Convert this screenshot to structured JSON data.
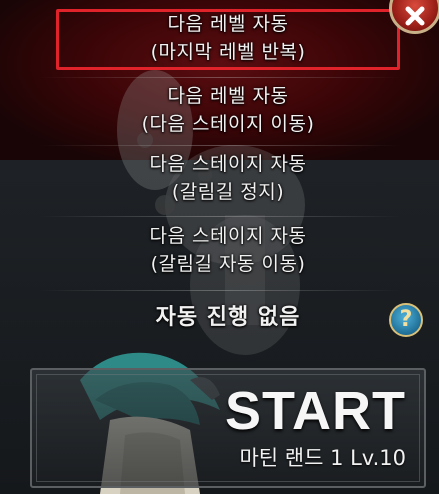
{
  "menu": {
    "options": [
      {
        "line1": "다음 레벨 자동",
        "line2": "(마지막 레벨 반복)",
        "selected": true
      },
      {
        "line1": "다음 레벨 자동",
        "line2": "(다음 스테이지 이동)",
        "selected": false
      },
      {
        "line1": "다음 스테이지 자동",
        "line2": "(갈림길 정지)",
        "selected": false
      },
      {
        "line1": "다음 스테이지 자동",
        "line2": "(갈림길 자동 이동)",
        "selected": false
      },
      {
        "line1": "자동 진행 없음",
        "selected": false
      }
    ]
  },
  "start": {
    "label": "START",
    "stage": "마틴 랜드 1 Lv.10"
  },
  "icons": {
    "close": "close-icon",
    "help": "help-icon"
  },
  "colors": {
    "highlight": "#e0232b",
    "background_top": "#3a0507",
    "background_bottom": "#1e2226"
  }
}
